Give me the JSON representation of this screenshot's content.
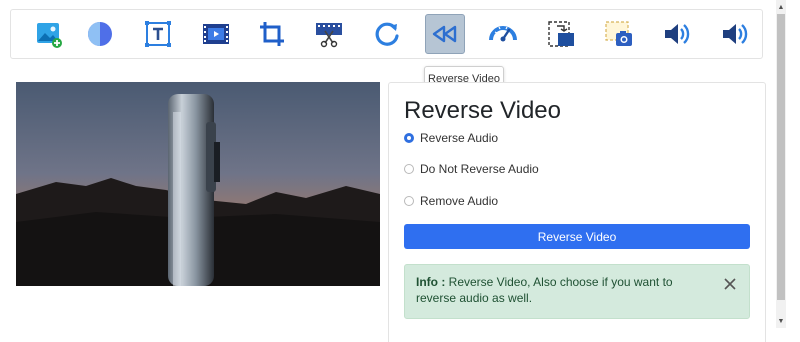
{
  "toolbar": {
    "tools": [
      {
        "icon": "add-image-icon"
      },
      {
        "icon": "color-filter-icon"
      },
      {
        "icon": "text-icon"
      },
      {
        "icon": "film-icon"
      },
      {
        "icon": "crop-icon"
      },
      {
        "icon": "cut-video-icon"
      },
      {
        "icon": "rotate-icon"
      },
      {
        "icon": "reverse-video-icon",
        "active": true
      },
      {
        "icon": "speedometer-icon"
      },
      {
        "icon": "resize-icon"
      },
      {
        "icon": "screenshot-camera-icon"
      },
      {
        "icon": "volume-icon"
      },
      {
        "icon": "volume-icon"
      }
    ]
  },
  "tooltip": "Reverse Video",
  "panel": {
    "title": "Reverse Video",
    "options": [
      {
        "label": "Reverse Audio",
        "checked": true
      },
      {
        "label": "Do Not Reverse Audio",
        "checked": false
      },
      {
        "label": "Remove Audio",
        "checked": false
      }
    ],
    "button_label": "Reverse Video",
    "info": {
      "prefix": "Info :",
      "text": " Reverse Video, Also choose if you want to reverse audio as well."
    }
  },
  "colors": {
    "primary": "#2f6ff0",
    "alert_bg": "#d4eadd",
    "active_tool": "#b6c5d4"
  }
}
